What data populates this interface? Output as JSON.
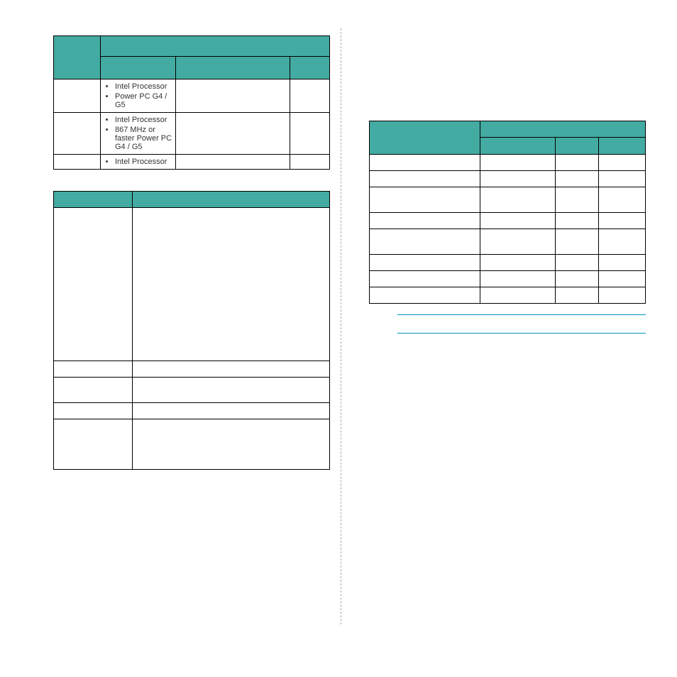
{
  "c1": "Intel Processor",
  "c2": "Power PC G4 / G5",
  "c3": "Intel Processor",
  "c4": "867 MHz or faster Power PC G4 / G5",
  "c5": "Intel Processor"
}
